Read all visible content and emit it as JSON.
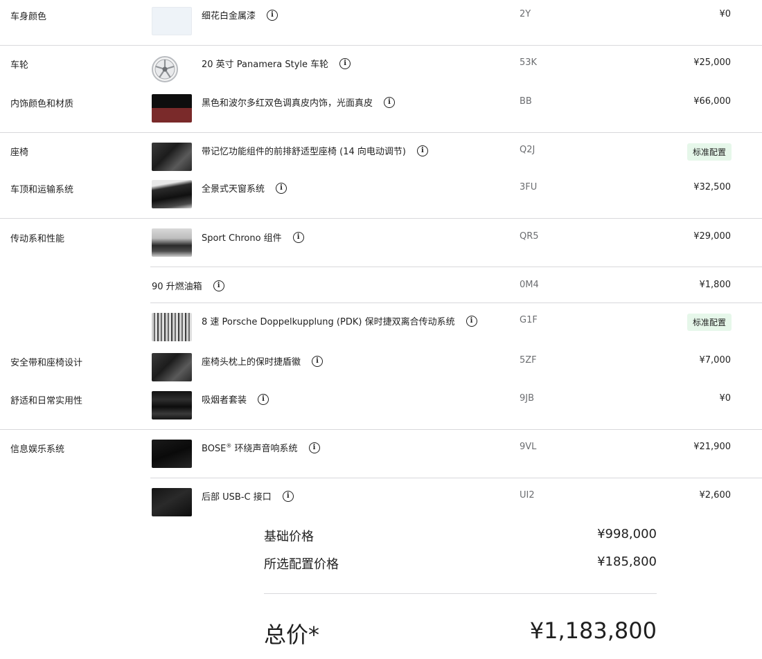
{
  "rows": [
    {
      "category": "车身颜色",
      "description": "细花白金属漆",
      "code": "2Y",
      "price": "¥0"
    },
    {
      "category": "车轮",
      "description": "20 英寸 Panamera Style 车轮",
      "code": "53K",
      "price": "¥25,000"
    },
    {
      "category": "内饰颜色和材质",
      "description": "黑色和波尔多红双色调真皮内饰，光面真皮",
      "code": "BB",
      "price": "¥66,000"
    },
    {
      "category": "座椅",
      "description": "带记忆功能组件的前排舒适型座椅 (14 向电动调节)",
      "code": "Q2J",
      "badge": "标准配置"
    },
    {
      "category": "车顶和运输系统",
      "description": "全景式天窗系统",
      "code": "3FU",
      "price": "¥32,500"
    },
    {
      "category": "传动系和性能",
      "description": "Sport Chrono 组件",
      "code": "QR5",
      "price": "¥29,000"
    },
    {
      "description": "90 升燃油箱",
      "code": "0M4",
      "price": "¥1,800"
    },
    {
      "description": "8 速 Porsche Doppelkupplung (PDK) 保时捷双离合传动系统",
      "code": "G1F",
      "badge": "标准配置"
    },
    {
      "category": "安全带和座椅设计",
      "description": "座椅头枕上的保时捷盾徽",
      "code": "5ZF",
      "price": "¥7,000"
    },
    {
      "category": "舒适和日常实用性",
      "description": "吸烟者套装",
      "code": "9JB",
      "price": "¥0"
    },
    {
      "category": "信息娱乐系统",
      "description": "BOSE",
      "description_sup": "®",
      "description_rest": " 环绕声音响系统",
      "code": "9VL",
      "price": "¥21,900"
    },
    {
      "description": "后部 USB-C 接口",
      "code": "UI2",
      "price": "¥2,600"
    }
  ],
  "summary": {
    "base_label": "基础价格",
    "base_value": "¥998,000",
    "options_label": "所选配置价格",
    "options_value": "¥185,800",
    "total_label": "总价*",
    "total_value": "¥1,183,800"
  },
  "icons": {
    "info": "info-icon"
  },
  "colors": {
    "badge_bg": "#e6f7ea",
    "divider": "#d8d8db",
    "code_gray": "#6b6d70"
  }
}
